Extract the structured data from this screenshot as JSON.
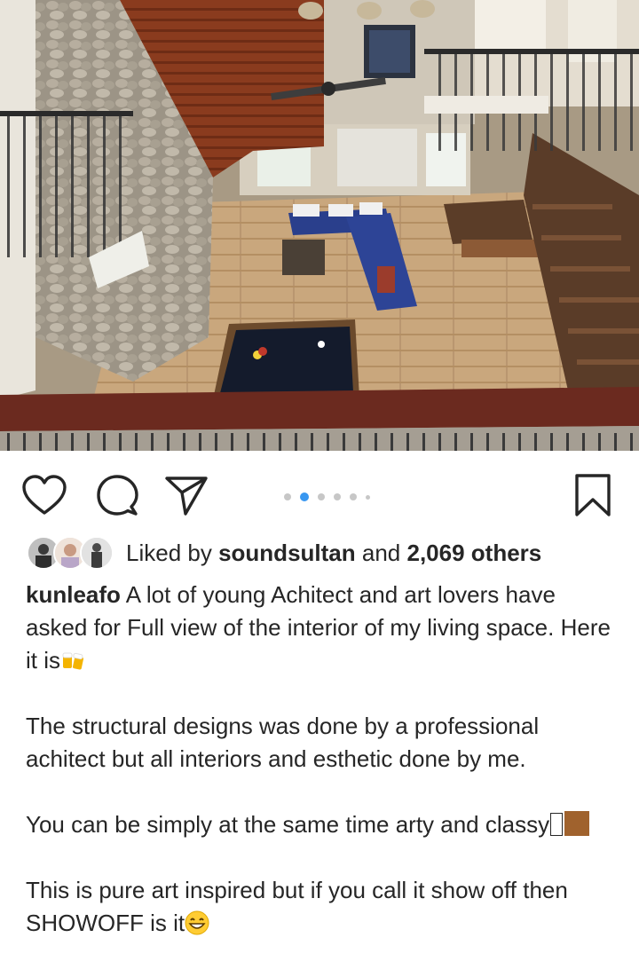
{
  "post": {
    "image_alt": "Aerial view of a two-storey living room with a pool table, blue sofa and wooden staircase",
    "carousel": {
      "total": 6,
      "current": 2
    },
    "likes": {
      "prefix": "Liked by",
      "liker": "soundsultan",
      "joiner": "and",
      "others": "2,069 others"
    },
    "caption": {
      "username": "kunleafo",
      "line1": "A lot of young Achitect and art lovers have asked for Full view of the interior of my living space. Here it is",
      "line2": "The structural designs was done by a professional achitect but all interiors and esthetic done by me.",
      "line3a": "You can be simply at the same time arty and classy",
      "line3_glyph": "\u0000",
      "line4": "This is pure art inspired but if you call it show off then SHOWOFF is it"
    }
  },
  "icons": {
    "like": "heart-icon",
    "comment": "comment-icon",
    "share": "paper-plane-icon",
    "save": "bookmark-icon"
  },
  "colors": {
    "carousel_active": "#3897f0",
    "carousel_inactive": "#c7c7c7",
    "text": "#262626",
    "brown_square": "#a0622d"
  }
}
